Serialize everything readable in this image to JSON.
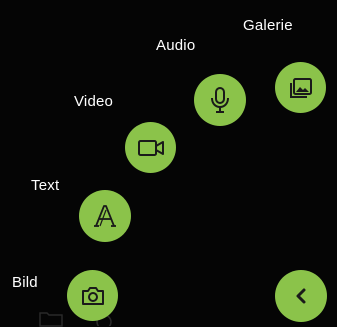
{
  "theme": {
    "accent": "#8bc34a",
    "icon_color": "#1a1a1a",
    "label_color": "#ffffff",
    "background": "#050505"
  },
  "menu": {
    "items": [
      {
        "key": "gallery",
        "label": "Galerie",
        "icon": "image-icon"
      },
      {
        "key": "audio",
        "label": "Audio",
        "icon": "microphone-icon"
      },
      {
        "key": "video",
        "label": "Video",
        "icon": "video-camera-icon"
      },
      {
        "key": "text",
        "label": "Text",
        "icon": "text-font-icon"
      },
      {
        "key": "image",
        "label": "Bild",
        "icon": "camera-icon"
      }
    ],
    "collapse": {
      "icon": "chevron-left-icon"
    }
  }
}
